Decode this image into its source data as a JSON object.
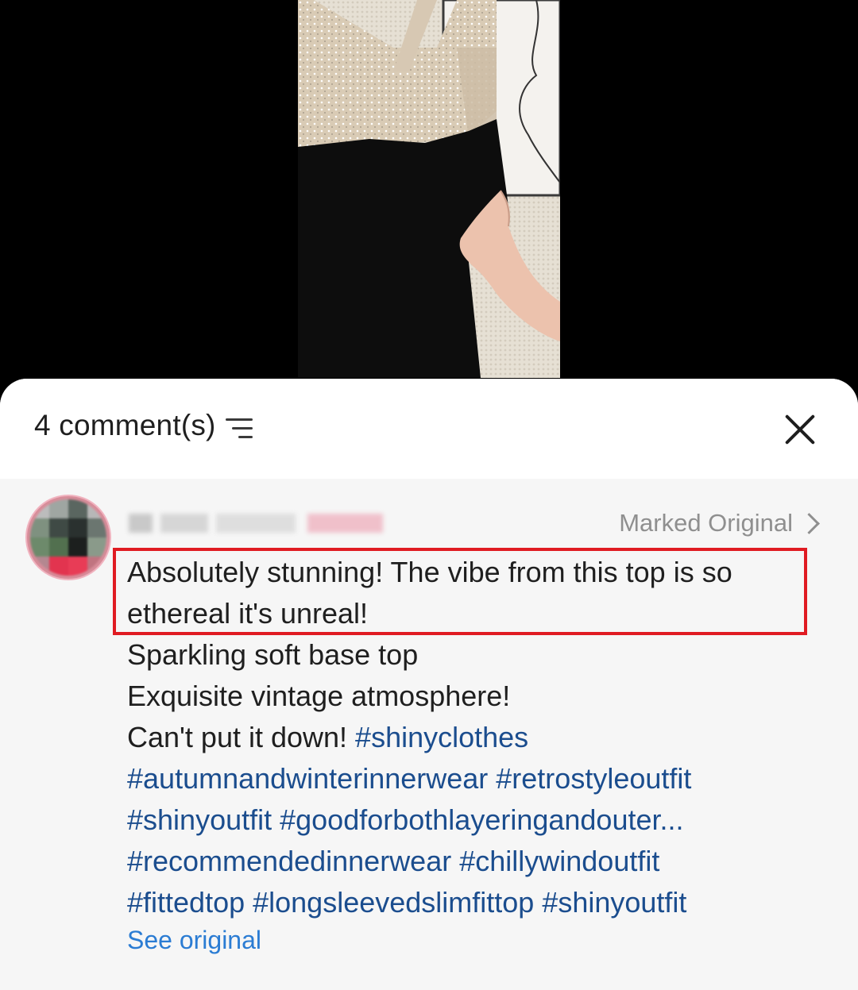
{
  "video": {
    "background_color": "#000000",
    "content": "video-thumbnail"
  },
  "comments_panel": {
    "count_label": "4 comment(s)",
    "sort_icon": "sort-lines-icon",
    "close_icon": "close-x-icon"
  },
  "comment": {
    "avatar": "avatar-pixelated",
    "username": "",
    "marked_original_label": "Marked Original",
    "chevron_icon": "chevron-right-icon",
    "lines": {
      "l1": "Absolutely stunning! The vibe from this top is so",
      "l2": "ethereal it's unreal!",
      "l3": "Sparkling soft base top",
      "l4": "Exquisite vintage atmosphere!",
      "l5_text": "Can't put it down! ",
      "l5_tag": "#shinyclothes",
      "l6": "#autumnandwinterinnerwear #retrostyleoutfit",
      "l7": "#shinyoutfit #goodforbothlayeringandouter...",
      "l8": "#recommendedinnerwear  #chillywindoutfit",
      "l9": "#fittedtop  #longsleevedslimfittop #shinyoutfit"
    },
    "see_original_label": "See original"
  },
  "colors": {
    "hashtag": "#1b4d8e",
    "link": "#2b7cd3",
    "highlight_border": "#e01b22",
    "secondary_text": "#8f8f8f"
  }
}
